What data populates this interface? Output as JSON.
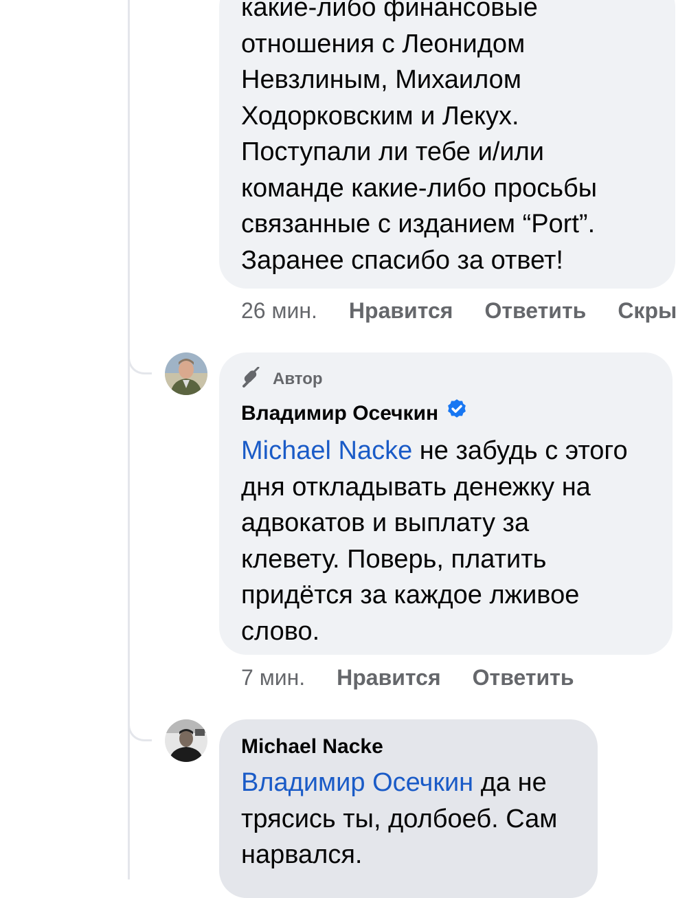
{
  "comment_top": {
    "lines": [
      "какие-либо финансовые",
      "отношения с Леонидом",
      "Невзлиным, Михаилом",
      "Ходорковским и Лекух.",
      "Поступали ли тебе и/или",
      "команде какие-либо просьбы",
      "связанные с изданием “Port”.",
      "Заранее спасибо за ответ!"
    ],
    "time": "26 мин.",
    "like": "Нравится",
    "reply": "Ответить",
    "hide": "Скры"
  },
  "comment_author": {
    "badge_icon": "pen-mic-icon",
    "badge": "Автор",
    "name": "Владимир Осечкин",
    "verified_icon": "verified-badge-icon",
    "mention": "Michael Nacke",
    "line1_rest": " не забудь с этого",
    "lines": [
      "дня откладывать денежку на",
      "адвокатов и выплату за",
      "клевету. Поверь, платить",
      "придётся за каждое лживое",
      "слово."
    ],
    "time": "7 мин.",
    "like": "Нравится",
    "reply": "Ответить"
  },
  "comment_reply": {
    "name": "Michael Nacke",
    "mention": "Владимир Осечкин",
    "line1_rest": " да не",
    "lines": [
      "трясись ты, долбоеб. Сам",
      "нарвался."
    ]
  },
  "colors": {
    "bubble": "#f0f2f5",
    "bubble_selected": "#e4e6eb",
    "mention": "#1a5bc7",
    "verified": "#1877f2",
    "meta": "#65676b"
  }
}
